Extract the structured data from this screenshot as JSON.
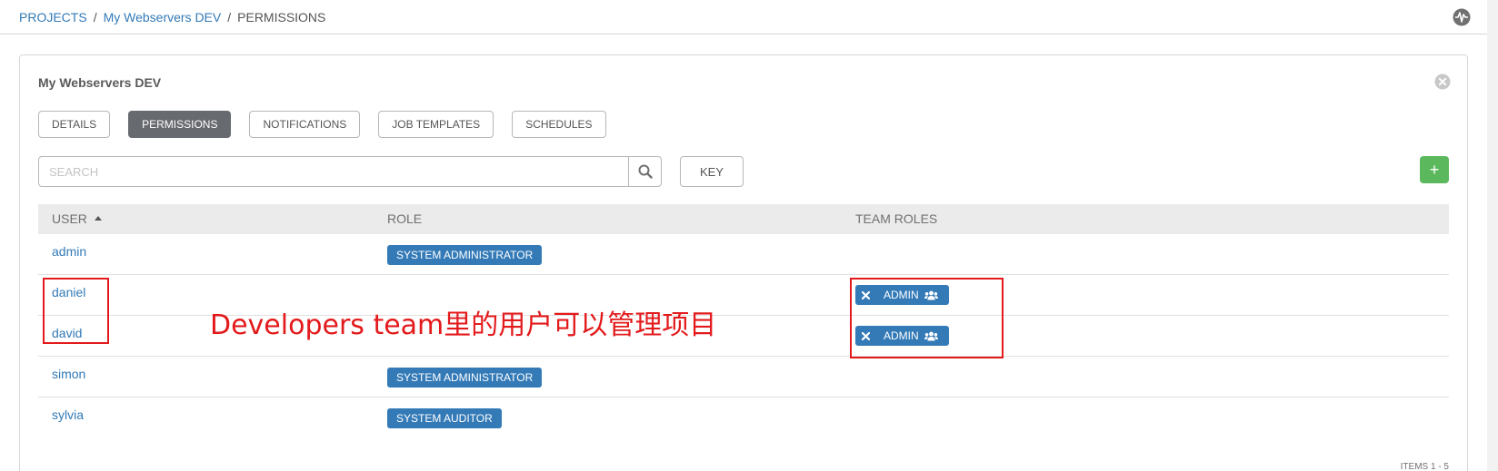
{
  "breadcrumb": {
    "projects": "PROJECTS",
    "project": "My Webservers DEV",
    "current": "PERMISSIONS",
    "separator": "/"
  },
  "panel": {
    "title": "My Webservers DEV"
  },
  "tabs": [
    {
      "label": "DETAILS",
      "active": false
    },
    {
      "label": "PERMISSIONS",
      "active": true
    },
    {
      "label": "NOTIFICATIONS",
      "active": false
    },
    {
      "label": "JOB TEMPLATES",
      "active": false
    },
    {
      "label": "SCHEDULES",
      "active": false
    }
  ],
  "search": {
    "placeholder": "SEARCH",
    "key_label": "KEY",
    "add_label": "+"
  },
  "table": {
    "columns": {
      "user": "USER",
      "role": "ROLE",
      "team_roles": "TEAM ROLES"
    },
    "rows": [
      {
        "user": "admin",
        "role": "SYSTEM ADMINISTRATOR",
        "team_role": ""
      },
      {
        "user": "daniel",
        "role": "",
        "team_role": "ADMIN"
      },
      {
        "user": "david",
        "role": "",
        "team_role": "ADMIN"
      },
      {
        "user": "simon",
        "role": "SYSTEM ADMINISTRATOR",
        "team_role": ""
      },
      {
        "user": "sylvia",
        "role": "SYSTEM AUDITOR",
        "team_role": ""
      }
    ]
  },
  "pagination": {
    "items_label": "ITEMS 1 - 5"
  },
  "annotation": {
    "text": "Developers team里的用户可以管理项目",
    "color": "#e31a1c"
  },
  "colors": {
    "link": "#337ab7",
    "badge": "#337ab7",
    "active_tab": "#676a6f",
    "add_button": "#5cb85c"
  },
  "icons": {
    "activity": "activity-stream-icon",
    "close": "close-circle-icon",
    "search": "search-icon",
    "remove": "times-icon",
    "team": "users-icon",
    "sort": "sort-up-icon"
  }
}
